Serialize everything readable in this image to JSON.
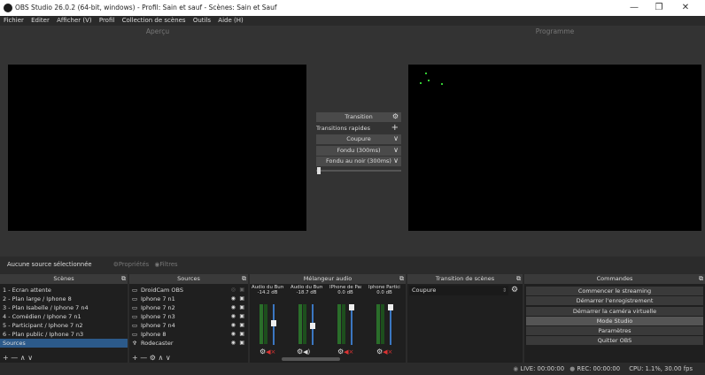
{
  "window": {
    "title": "OBS Studio 26.0.2 (64-bit, windows) - Profil: Sain et sauf - Scènes: Sain et Sauf",
    "minimize": "—",
    "restore": "❐",
    "close": "✕"
  },
  "menu": [
    "Fichier",
    "Editer",
    "Afficher (V)",
    "Profil",
    "Collection de scènes",
    "Outils",
    "Aide (H)"
  ],
  "preview": {
    "left_title": "Aperçu",
    "right_title": "Programme"
  },
  "transition_panel": {
    "transition_label": "Transition",
    "quick_label": "Transitions rapides",
    "items": [
      "Coupure",
      "Fondu (300ms)",
      "Fondu au noir (300ms)"
    ]
  },
  "source_status": {
    "text": "Aucune source sélectionnée",
    "properties": "Propriétés",
    "filters": "Filtres"
  },
  "scenes": {
    "title": "Scènes",
    "items": [
      "1 - Ecran attente",
      "2 - Plan large / Iphone 8",
      "3 - Plan Isabelle / Iphone 7 n4",
      "4 - Comédien / Iphone 7 n1",
      "5 - Participant / Iphone 7 n2",
      "6 - Plan public / Iphone 7 n3",
      "Sources"
    ],
    "toolbar": "+ —   ∧ ∨"
  },
  "sources": {
    "title": "Sources",
    "items": [
      "DroidCam OBS",
      "Iphone 7 n1",
      "Iphone 7 n2",
      "Iphone 7 n3",
      "Iphone 7 n4",
      "Iphone 8",
      "Rodecaster"
    ],
    "toolbar": "+ — ⚙  ∧ ∨"
  },
  "mixer": {
    "title": "Mélangeur audio",
    "channels": [
      {
        "name": "Audio du Bureau",
        "db": "-14.2 dB",
        "level": 0.55
      },
      {
        "name": "Audio du Bureau",
        "db": "-18.7 dB",
        "level": 0.45
      },
      {
        "name": "IPhone de Pasca",
        "db": "0.0 dB",
        "level": 1.0
      },
      {
        "name": "Iphone Particip",
        "db": "0.0 dB",
        "level": 1.0
      }
    ]
  },
  "scene_transitions": {
    "title": "Transition de scènes",
    "value": "Coupure"
  },
  "commands": {
    "title": "Commandes",
    "items": [
      "Commencer le streaming",
      "Démarrer l'enregistrement",
      "Démarrer la caméra virtuelle",
      "Mode Studio",
      "Paramètres",
      "Quitter OBS"
    ]
  },
  "status_bar": {
    "live": "LIVE: 00:00:00",
    "rec": "REC: 00:00:00",
    "cpu": "CPU: 1.1%, 30.00 fps"
  },
  "colors": {
    "accent": "#2c5a8a",
    "fader": "#3b77c2",
    "meter": "#2a6e2a"
  }
}
